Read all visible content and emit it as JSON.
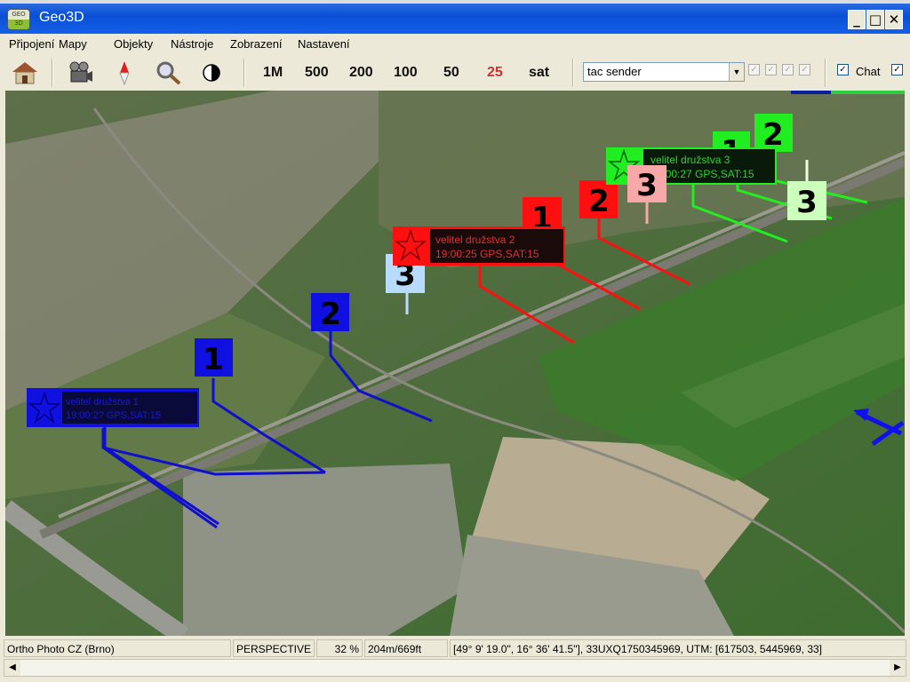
{
  "window": {
    "title": "Geo3D",
    "icon": "geo3d-app-icon",
    "minimize": "_",
    "maximize": "□",
    "close": "✕"
  },
  "menu": [
    {
      "label": "Připojení",
      "accel": "P"
    },
    {
      "label": "Mapy",
      "accel": "M"
    },
    {
      "label": "Objekty",
      "accel": "O"
    },
    {
      "label": "Nástroje",
      "accel": "N"
    },
    {
      "label": "Zobrazení",
      "accel": "Z"
    },
    {
      "label": "Nastavení",
      "accel": "a"
    }
  ],
  "toolbar": {
    "icons": [
      "home-icon",
      "camera-icon",
      "compass-icon",
      "magnifier-icon",
      "contrast-icon"
    ],
    "scales": [
      {
        "label": "1M",
        "active": false
      },
      {
        "label": "500",
        "active": false
      },
      {
        "label": "200",
        "active": false
      },
      {
        "label": "100",
        "active": false
      },
      {
        "label": "50",
        "active": false
      },
      {
        "label": "25",
        "active": true
      },
      {
        "label": "sat",
        "active": false
      }
    ],
    "active_color": "#d03030",
    "sender_combo": {
      "value": "tac sender"
    },
    "disabled_checks": [
      true,
      true,
      true,
      true
    ],
    "chat_checkbox": {
      "label": "Chat",
      "checked": true
    },
    "extra_checkbox": {
      "checked": true
    }
  },
  "map": {
    "progress": {
      "blue_fraction": 0.35,
      "green_fraction": 0.65,
      "colors": [
        "#0a1ea0",
        "#2ecc40"
      ]
    },
    "squads": [
      {
        "color": "#1010e0",
        "leader_label": {
          "line1": "velitel družstva 1",
          "line2": "19:00:2? GPS,SAT:15",
          "legible": false
        },
        "units": [
          "1",
          "2"
        ]
      },
      {
        "color": "#ff1010",
        "leader_label": {
          "line1": "velitel družstva 2",
          "line2": "19:00:25 GPS,SAT:15"
        },
        "units": [
          "1",
          "2",
          "3"
        ]
      },
      {
        "color": "#20ee20",
        "leader_label": {
          "line1": "velitel družstva 3",
          "line2": "19:00:27 GPS,SAT:15"
        },
        "units": [
          "1",
          "2",
          "3"
        ]
      }
    ],
    "markers": [
      {
        "text": "1",
        "bg": "#1010e0"
      },
      {
        "text": "2",
        "bg": "#1010e0"
      },
      {
        "text": "3",
        "bg": "#b8dcff"
      },
      {
        "text": "1",
        "bg": "#ff1010"
      },
      {
        "text": "2",
        "bg": "#ff1010"
      },
      {
        "text": "3",
        "bg": "#f8a8a8"
      },
      {
        "text": "1",
        "bg": "#20ee20"
      },
      {
        "text": "2",
        "bg": "#20ee20"
      },
      {
        "text": "3",
        "bg": "#ccffbb"
      }
    ],
    "aircraft_icon": "aircraft-icon"
  },
  "status": {
    "map_source": "Ortho Photo CZ (Brno)",
    "view_mode": "PERSPECTIVE",
    "zoom": "32 %",
    "altitude": "204m/669ft",
    "coords": "[49° 9' 19.0\", 16° 36' 41.5\"],  33UXQ1750345969,  UTM: [617503, 5445969, 33]"
  }
}
